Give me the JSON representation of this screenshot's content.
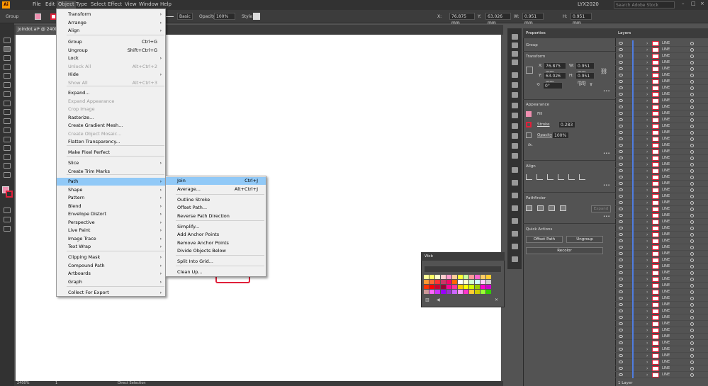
{
  "app": {
    "logo": "Ai",
    "user": "LYX2020",
    "search_placeholder": "Search Adobe Stock"
  },
  "menubar": [
    "File",
    "Edit",
    "Object",
    "Type",
    "Select",
    "Effect",
    "View",
    "Window",
    "Help"
  ],
  "control": {
    "selection": "Group",
    "stroke_style": "Basic",
    "opacity_label": "Opacity:",
    "opacity_value": "100%",
    "style_label": "Style:",
    "x_label": "X:",
    "x_value": "76.875 mm",
    "y_label": "Y:",
    "y_value": "63.026 mm",
    "w_label": "W:",
    "w_value": "0.951 mm",
    "h_label": "H:",
    "h_value": "0.951 mm"
  },
  "document": {
    "tab": "Joindot.ai* @ 2400% (RGB/GPU Preview)",
    "zoom": "2400%",
    "page": "1",
    "status": "Direct Selection"
  },
  "object_menu": [
    {
      "label": "Transform",
      "sub": true
    },
    {
      "label": "Arrange",
      "sub": true
    },
    {
      "label": "Align",
      "sub": true
    },
    {
      "label": "Group",
      "shortcut": "Ctrl+G"
    },
    {
      "label": "Ungroup",
      "shortcut": "Shift+Ctrl+G"
    },
    {
      "label": "Lock",
      "sub": true
    },
    {
      "label": "Unlock All",
      "shortcut": "Alt+Ctrl+2",
      "disabled": true
    },
    {
      "label": "Hide",
      "sub": true
    },
    {
      "label": "Show All",
      "shortcut": "Alt+Ctrl+3",
      "disabled": true
    },
    {
      "label": "Expand..."
    },
    {
      "label": "Expand Appearance",
      "disabled": true
    },
    {
      "label": "Crop Image",
      "disabled": true
    },
    {
      "label": "Rasterize..."
    },
    {
      "label": "Create Gradient Mesh..."
    },
    {
      "label": "Create Object Mosaic...",
      "disabled": true
    },
    {
      "label": "Flatten Transparency..."
    },
    {
      "label": "Make Pixel Perfect"
    },
    {
      "label": "Slice",
      "sub": true
    },
    {
      "label": "Create Trim Marks"
    },
    {
      "label": "Path",
      "sub": true,
      "highlight": true
    },
    {
      "label": "Shape",
      "sub": true
    },
    {
      "label": "Pattern",
      "sub": true
    },
    {
      "label": "Blend",
      "sub": true
    },
    {
      "label": "Envelope Distort",
      "sub": true
    },
    {
      "label": "Perspective",
      "sub": true
    },
    {
      "label": "Live Paint",
      "sub": true
    },
    {
      "label": "Image Trace",
      "sub": true
    },
    {
      "label": "Text Wrap",
      "sub": true
    },
    {
      "label": "Clipping Mask",
      "sub": true
    },
    {
      "label": "Compound Path",
      "sub": true
    },
    {
      "label": "Artboards",
      "sub": true
    },
    {
      "label": "Graph",
      "sub": true
    },
    {
      "label": "Collect For Export",
      "sub": true
    }
  ],
  "path_menu": [
    {
      "label": "Join",
      "shortcut": "Ctrl+J",
      "highlight": true
    },
    {
      "label": "Average...",
      "shortcut": "Alt+Ctrl+J"
    },
    {
      "label": "Outline Stroke"
    },
    {
      "label": "Offset Path..."
    },
    {
      "label": "Reverse Path Direction"
    },
    {
      "label": "Simplify..."
    },
    {
      "label": "Add Anchor Points"
    },
    {
      "label": "Remove Anchor Points"
    },
    {
      "label": "Divide Objects Below"
    },
    {
      "label": "Split Into Grid..."
    },
    {
      "label": "Clean Up..."
    }
  ],
  "properties": {
    "title": "Properties",
    "group": "Group",
    "transform": "Transform",
    "x": "76.875 mm",
    "y": "63.026 mm",
    "w": "0.951 mm",
    "h": "0.951 mm",
    "x_label": "X:",
    "y_label": "Y:",
    "w_label": "W:",
    "h_label": "H:",
    "angle": "0°",
    "appearance": "Appearance",
    "fill": "Fill",
    "stroke": "Stroke",
    "stroke_value": "0.283",
    "opacity": "Opacity",
    "opacity_value": "100%",
    "fx": "fx.",
    "align": "Align",
    "pathfinder": "Pathfinder",
    "expand": "Expand",
    "quick_actions": "Quick Actions",
    "offset_path": "Offset Path",
    "ungroup": "Ungroup",
    "recolor": "Recolor"
  },
  "layers": {
    "title": "Layers",
    "row_label": "LINE",
    "footer": "1 Layer"
  },
  "web_panel": {
    "title": "Web"
  },
  "colors": {
    "accent_fill": "#f08fb0",
    "stroke_red": "#e0203a",
    "menu_highlight": "#91c9f7",
    "layer_bar": "#4f7de0"
  }
}
